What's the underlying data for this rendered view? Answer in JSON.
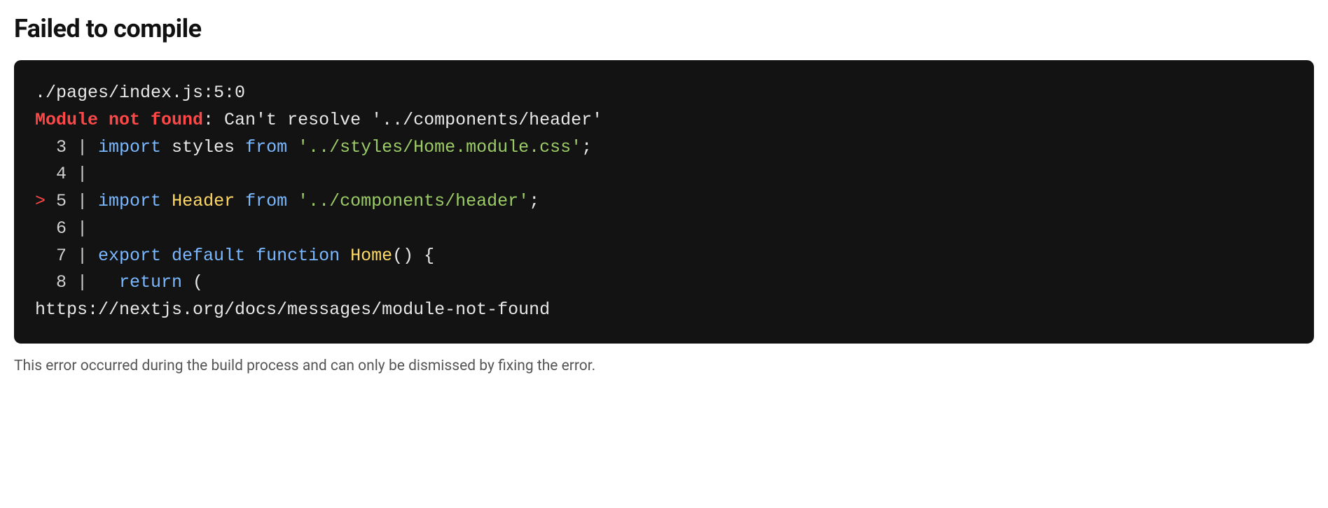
{
  "heading": "Failed to compile",
  "error": {
    "file_location": "./pages/index.js:5:0",
    "label": "Module not found",
    "message": ": Can't resolve '../components/header'"
  },
  "code": {
    "lines": [
      {
        "gutter": "  3 | ",
        "kw": "import",
        "ident": " styles ",
        "from": "from",
        "sp": " ",
        "str": "'../styles/Home.module.css'",
        "punct": ";"
      },
      {
        "gutter": "  4 | "
      },
      {
        "caret": "> ",
        "gutter": "5 | ",
        "kw": "import",
        "sp1": " ",
        "name": "Header",
        "sp2": " ",
        "from": "from",
        "sp3": " ",
        "str": "'../components/header'",
        "punct": ";"
      },
      {
        "gutter": "  6 | "
      },
      {
        "gutter": "  7 | ",
        "kw1": "export",
        "sp1": " ",
        "kw2": "default",
        "sp2": " ",
        "kw3": "function",
        "sp3": " ",
        "name": "Home",
        "punct": "() {"
      },
      {
        "gutter": "  8 |   ",
        "kw": "return",
        "punct": " ("
      }
    ],
    "doc_link": "https://nextjs.org/docs/messages/module-not-found"
  },
  "footer_note": "This error occurred during the build process and can only be dismissed by fixing the error."
}
